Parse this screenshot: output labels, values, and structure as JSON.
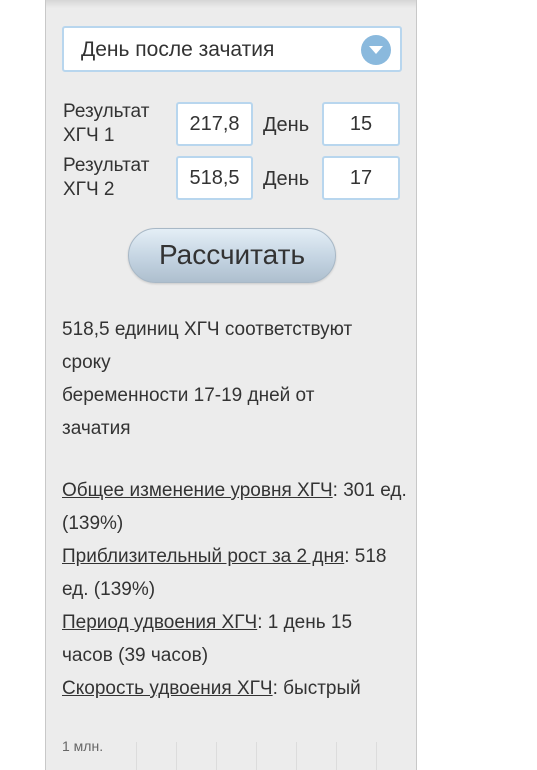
{
  "select": {
    "value": "День после зачатия"
  },
  "rows": [
    {
      "label": "Результат ХГЧ 1",
      "value": "217,8",
      "day_label": "День",
      "day": "15"
    },
    {
      "label": "Результат ХГЧ 2",
      "value": "518,5",
      "day_label": "День",
      "day": "17"
    }
  ],
  "calc_button": "Рассчитать",
  "result": {
    "line1": "518,5 единиц ХГЧ соответствуют",
    "line2": "сроку",
    "line3": "беременности 17-19 дней от",
    "line4": "зачатия"
  },
  "stats": {
    "total_change_label": "Общее изменение уровня ХГЧ",
    "total_change_value": "301 ед. (139%)",
    "growth_label": "Приблизительный рост за 2 дня",
    "growth_value": "518 ед. (139%)",
    "doubling_period_label": "Период удвоения ХГЧ",
    "doubling_period_value": "1 день 15 часов (39 часов)",
    "doubling_speed_label": "Скорость удвоения ХГЧ",
    "doubling_speed_value": "быстрый"
  },
  "chart": {
    "y_label": "1 млн."
  }
}
